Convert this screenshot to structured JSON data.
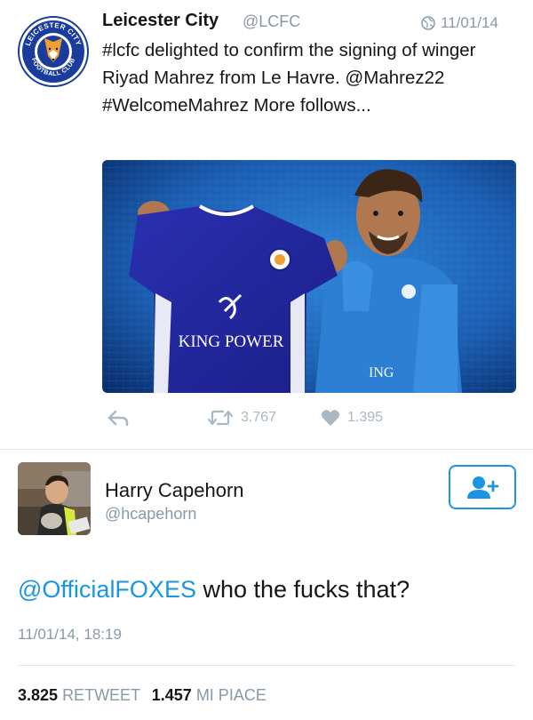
{
  "tweet": {
    "author_name": "Leicester City",
    "author_handle": "@LCFC",
    "date": "11/01/14",
    "text": "#lcfc delighted to confirm the signing of winger Riyad Mahrez from Le Havre. @Mahrez22 #WelcomeMahrez More follows...",
    "avatar_text_top": "LEICESTER CITY",
    "avatar_text_bottom": "FOOTBALL CLUB",
    "photo_shirt_sponsor": "KING POWER",
    "photo_partial_text": "ING",
    "retweet_count": "3.767",
    "like_count": "1.395"
  },
  "reply": {
    "author_name": "Harry Capehorn",
    "author_handle": "@hcapehorn",
    "mention": "@OfficialFOXES",
    "text": " who the fucks that?",
    "timestamp": "11/01/14, 18:19",
    "retweets_count": "3.825",
    "retweets_label": "RETWEET",
    "likes_count": "1.457",
    "likes_label": "MI PIACE"
  },
  "colors": {
    "link": "#1b95e0",
    "muted": "#8899a6",
    "icon": "#aab8c2",
    "lcfc_blue": "#1a3d9c"
  },
  "icons": [
    "globe-icon",
    "reply-icon",
    "retweet-icon",
    "heart-icon",
    "follow-icon"
  ]
}
